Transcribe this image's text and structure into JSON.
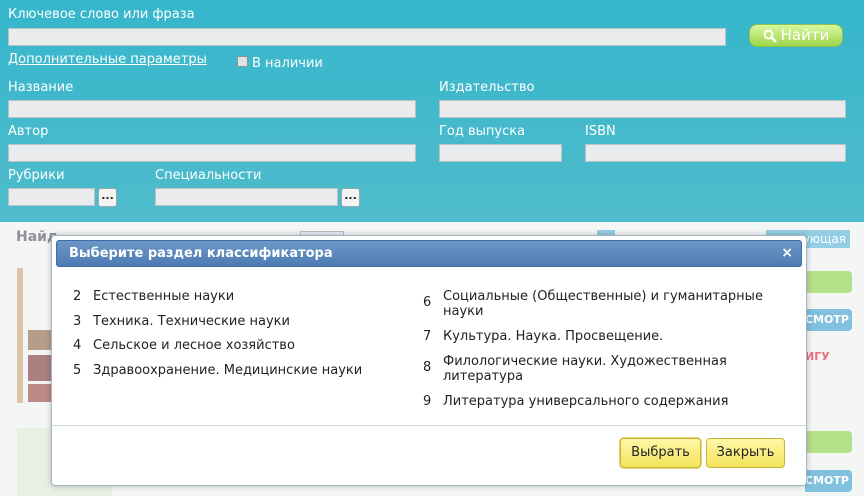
{
  "search": {
    "keyword_label": "Ключевое слово или фраза",
    "find_label": "Найти",
    "advanced_link": "Дополнительные параметры",
    "in_stock_label": "В наличии",
    "title_label": "Название",
    "publisher_label": "Издательство",
    "author_label": "Автор",
    "year_label": "Год выпуска",
    "isbn_label": "ISBN",
    "rubrics_label": "Рубрики",
    "specialties_label": "Специальности",
    "dots": "..."
  },
  "background": {
    "found_label": "Найд",
    "next_label": "ующая",
    "view_label_1": "СМОТР",
    "view_label_2": "СМОТР",
    "book_label": "ИГУ"
  },
  "modal": {
    "title": "Выберите раздел классификатора",
    "close": "×",
    "left_items": [
      {
        "num": "2",
        "text": "Естественные науки"
      },
      {
        "num": "3",
        "text": "Техника. Технические науки"
      },
      {
        "num": "4",
        "text": "Сельское и лесное хозяйство"
      },
      {
        "num": "5",
        "text": "Здравоохранение. Медицинские науки"
      }
    ],
    "right_items": [
      {
        "num": "6",
        "line1": "Социальные (Общественные) и гуманитарные",
        "line2": "науки"
      },
      {
        "num": "7",
        "line1": "Культура. Наука. Просвещение.",
        "line2": ""
      },
      {
        "num": "8",
        "line1": "Филологические науки. Художественная",
        "line2": "литература"
      },
      {
        "num": "9",
        "line1": "Литература универсального содержания",
        "line2": ""
      }
    ],
    "select_button": "Выбрать",
    "close_button": "Закрыть"
  }
}
